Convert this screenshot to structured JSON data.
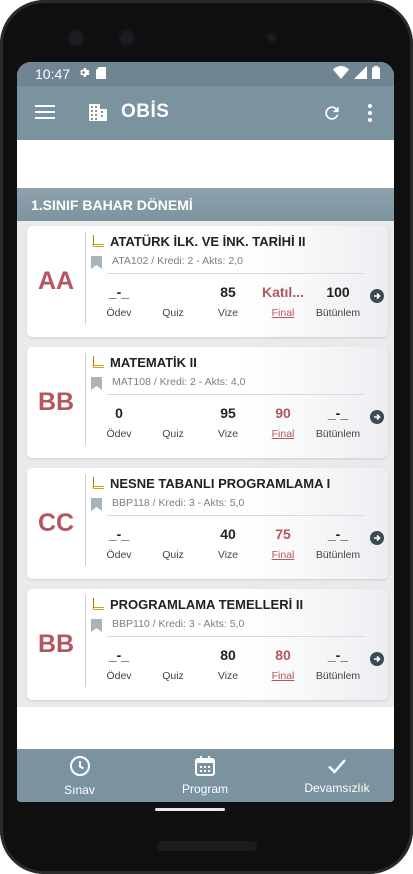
{
  "status": {
    "time": "10:47"
  },
  "app": {
    "title": "OBİS"
  },
  "section": {
    "title": "1.SINIF BAHAR DÖNEMİ"
  },
  "courses": [
    {
      "grade": "AA",
      "name": "ATATÜRK İLK. VE İNK. TARİHİ II",
      "meta": "ATA102 / Kredi: 2 - Akts: 2,0",
      "odev": "_-_",
      "quiz": "",
      "vize": "85",
      "final": "Katıl...",
      "butunleme": "100"
    },
    {
      "grade": "BB",
      "name": "MATEMATİK II",
      "meta": "MAT108 / Kredi: 2 - Akts: 4,0",
      "odev": "0",
      "quiz": "",
      "vize": "95",
      "final": "90",
      "butunleme": "_-_"
    },
    {
      "grade": "CC",
      "name": "NESNE TABANLI PROGRAMLAMA I",
      "meta": "BBP118 / Kredi: 3 - Akts: 5,0",
      "odev": "_-_",
      "quiz": "",
      "vize": "40",
      "final": "75",
      "butunleme": "_-_"
    },
    {
      "grade": "BB",
      "name": "PROGRAMLAMA TEMELLERİ II",
      "meta": "BBP110 / Kredi: 3 - Akts: 5,0",
      "odev": "_-_",
      "quiz": "",
      "vize": "80",
      "final": "80",
      "butunleme": "_-_"
    }
  ],
  "labels": {
    "odev": "Ödev",
    "quiz": "Quiz",
    "vize": "Vize",
    "final": "Final",
    "butunleme": "Bütünlem"
  },
  "nav": {
    "sinav": "Sınav",
    "program": "Program",
    "devamsizlik": "Devamsızlık"
  },
  "colors": {
    "appbar": "#7b939f",
    "grade": "#b4565c",
    "book": "#d4a418"
  },
  "icons": [
    "settings-icon",
    "sim-icon",
    "wifi-icon",
    "signal-icon",
    "battery-icon",
    "menu-icon",
    "building-icon",
    "refresh-icon",
    "more-vert-icon",
    "book-icon",
    "bookmark-icon",
    "arrow-right-circle-icon",
    "clock-icon",
    "calendar-icon",
    "check-icon"
  ]
}
